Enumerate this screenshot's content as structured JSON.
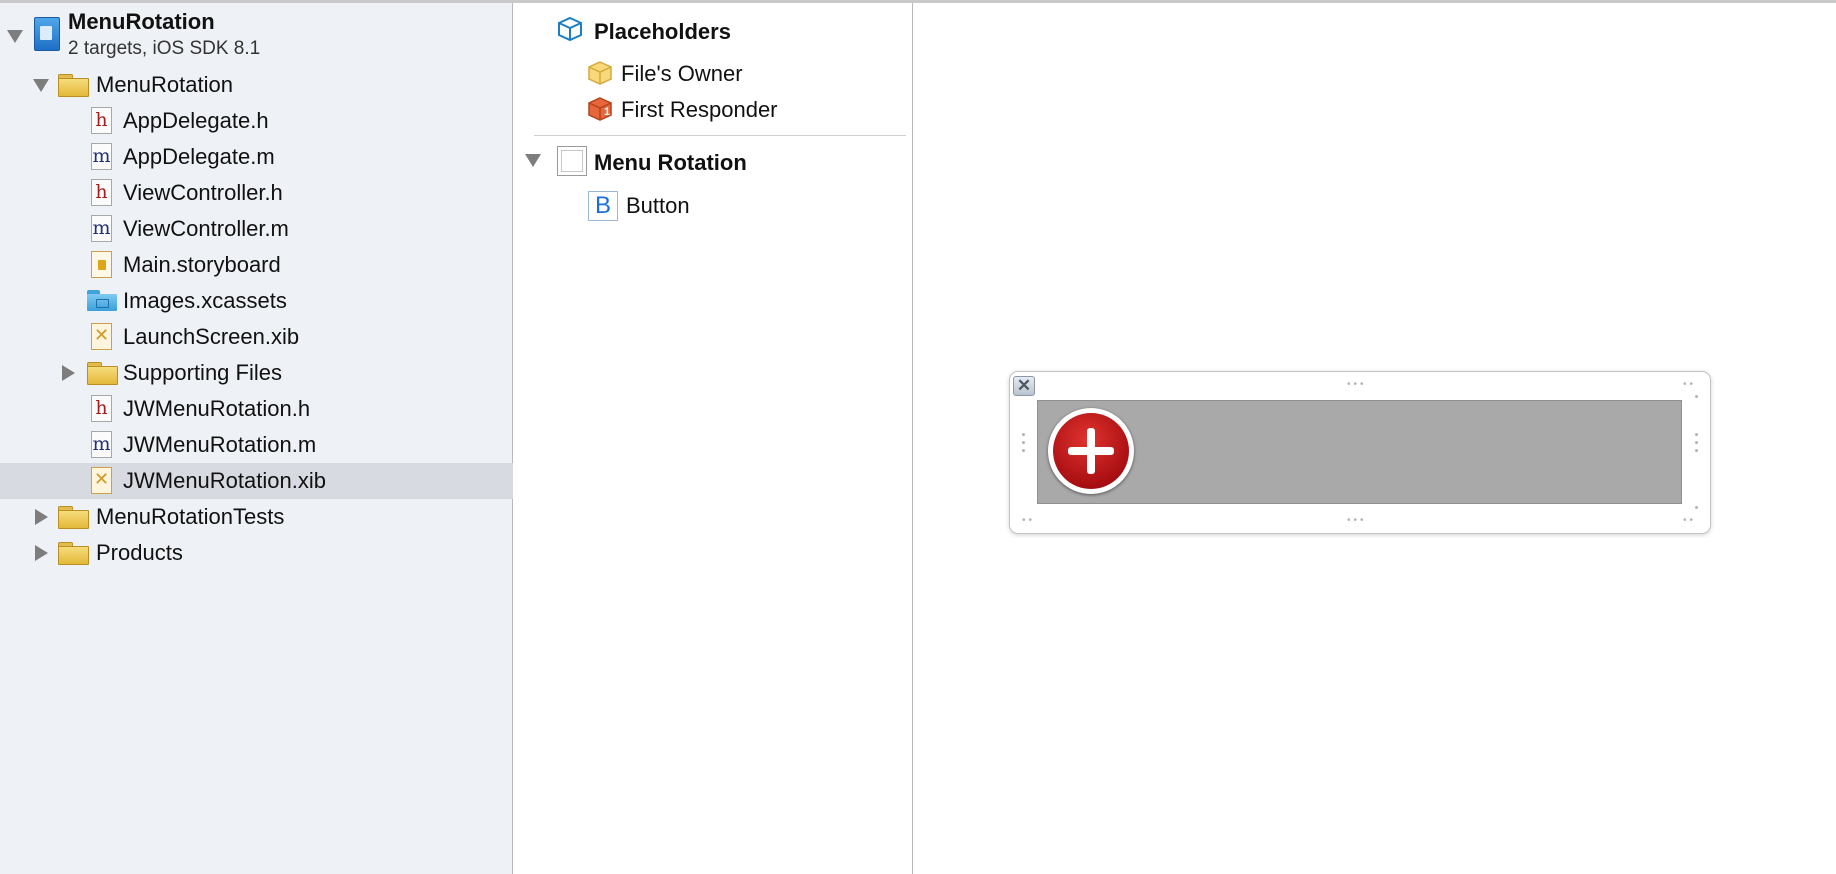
{
  "navigator": {
    "project": {
      "name": "MenuRotation",
      "subtitle": "2 targets, iOS SDK 8.1"
    },
    "items": [
      {
        "label": "MenuRotation",
        "kind": "group"
      },
      {
        "label": "AppDelegate.h",
        "kind": "header-file"
      },
      {
        "label": "AppDelegate.m",
        "kind": "implementation-file"
      },
      {
        "label": "ViewController.h",
        "kind": "header-file"
      },
      {
        "label": "ViewController.m",
        "kind": "implementation-file"
      },
      {
        "label": "Main.storyboard",
        "kind": "storyboard-file"
      },
      {
        "label": "Images.xcassets",
        "kind": "asset-catalog"
      },
      {
        "label": "LaunchScreen.xib",
        "kind": "xib-file"
      },
      {
        "label": "Supporting Files",
        "kind": "group"
      },
      {
        "label": "JWMenuRotation.h",
        "kind": "header-file"
      },
      {
        "label": "JWMenuRotation.m",
        "kind": "implementation-file"
      },
      {
        "label": "JWMenuRotation.xib",
        "kind": "xib-file",
        "selected": true
      },
      {
        "label": "MenuRotationTests",
        "kind": "group"
      },
      {
        "label": "Products",
        "kind": "group"
      }
    ],
    "file_glyphs": {
      "header": "h",
      "implementation": "m",
      "xib": "✕"
    }
  },
  "outline": {
    "placeholders": {
      "title": "Placeholders",
      "items": [
        "File's Owner",
        "First Responder"
      ],
      "responder_badge": "1"
    },
    "view": {
      "title": "Menu Rotation",
      "children": [
        "Button"
      ],
      "button_glyph": "B"
    }
  },
  "canvas": {
    "close_glyph": "✕",
    "button_icon": "plus-icon",
    "colors": {
      "view_background": "#a9a9a9",
      "button_red": "#c41b1c"
    }
  },
  "colors": {
    "navigator_background": "#eef1f5",
    "selection": "#d7dbe1",
    "folder_yellow": "#ecc54f",
    "header_red": "#a4201e",
    "implementation_blue": "#233275",
    "button_blue": "#1a6fd8"
  }
}
